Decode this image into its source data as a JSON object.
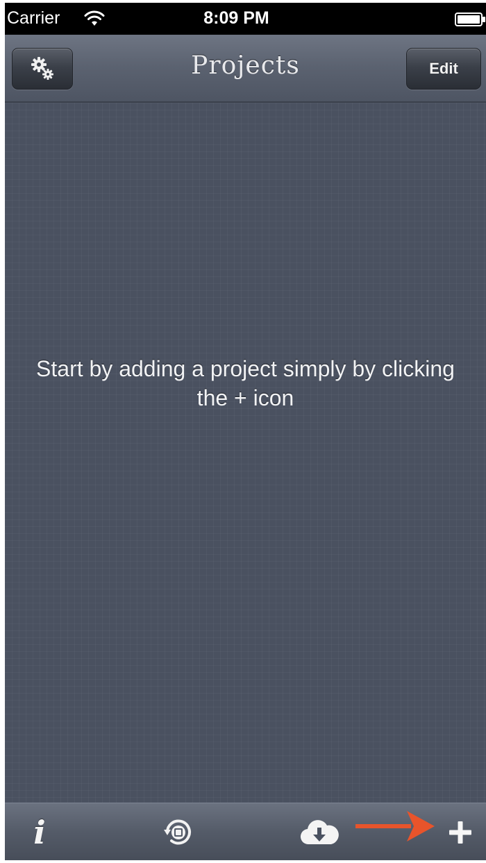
{
  "status_bar": {
    "carrier": "Carrier",
    "time": "8:09 PM",
    "wifi_icon": "wifi-icon",
    "battery_icon": "battery-icon"
  },
  "nav_bar": {
    "title": "Projects",
    "settings_icon": "gears-icon",
    "edit_label": "Edit"
  },
  "content": {
    "empty_message": "Start by adding a project simply by clicking the + icon"
  },
  "toolbar": {
    "items": [
      {
        "icon": "info-icon",
        "glyph": "i"
      },
      {
        "icon": "sync-icon"
      },
      {
        "icon": "cloud-download-icon"
      },
      {
        "icon": "plus-icon"
      }
    ],
    "annotation_arrow_color": "#e8542b"
  },
  "colors": {
    "background": "#4a5160",
    "status_bar": "#000000",
    "text_light": "#f2f3f5",
    "annotation": "#e8542b"
  }
}
